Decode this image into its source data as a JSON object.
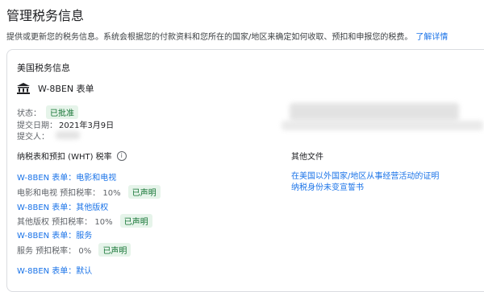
{
  "page": {
    "title": "管理税务信息",
    "intro": "提供或更新您的税务信息。系统会根据您的付款资料和您所在的国家/地区来确定如何收取、预扣和申报您的税费。",
    "learn_more": "了解详情"
  },
  "card": {
    "title": "美国税务信息",
    "form_name": "W-8BEN 表单",
    "status_label": "状态：",
    "status_value": "已批准",
    "submit_date_label": "提交日期：",
    "submit_date_value": "2021年3月9日",
    "submitter_label": "提交人："
  },
  "wht": {
    "heading": "纳税表和预扣 (WHT) 税率",
    "items": [
      {
        "link": "W-8BEN 表单：电影和电视",
        "rate_text": "电影和电视 预扣税率：",
        "rate": "10%",
        "badge": "已声明"
      },
      {
        "link": "W-8BEN 表单：其他版权",
        "rate_text": "其他版权 预扣税率：",
        "rate": "10%",
        "badge": "已声明"
      },
      {
        "link": "W-8BEN 表单：服务",
        "rate_text": "服务 预扣税率：",
        "rate": "0%",
        "badge": "已声明"
      },
      {
        "link": "W-8BEN 表单：默认"
      }
    ]
  },
  "other_docs": {
    "heading": "其他文件",
    "links": [
      "在美国以外国家/地区从事经营活动的证明",
      "纳税身份未变宣誓书"
    ]
  },
  "icons": {
    "form": "bank-icon",
    "info": "info-icon"
  },
  "colors": {
    "link": "#1a73e8",
    "badge_bg": "#e6f4ea",
    "badge_text": "#137333"
  }
}
